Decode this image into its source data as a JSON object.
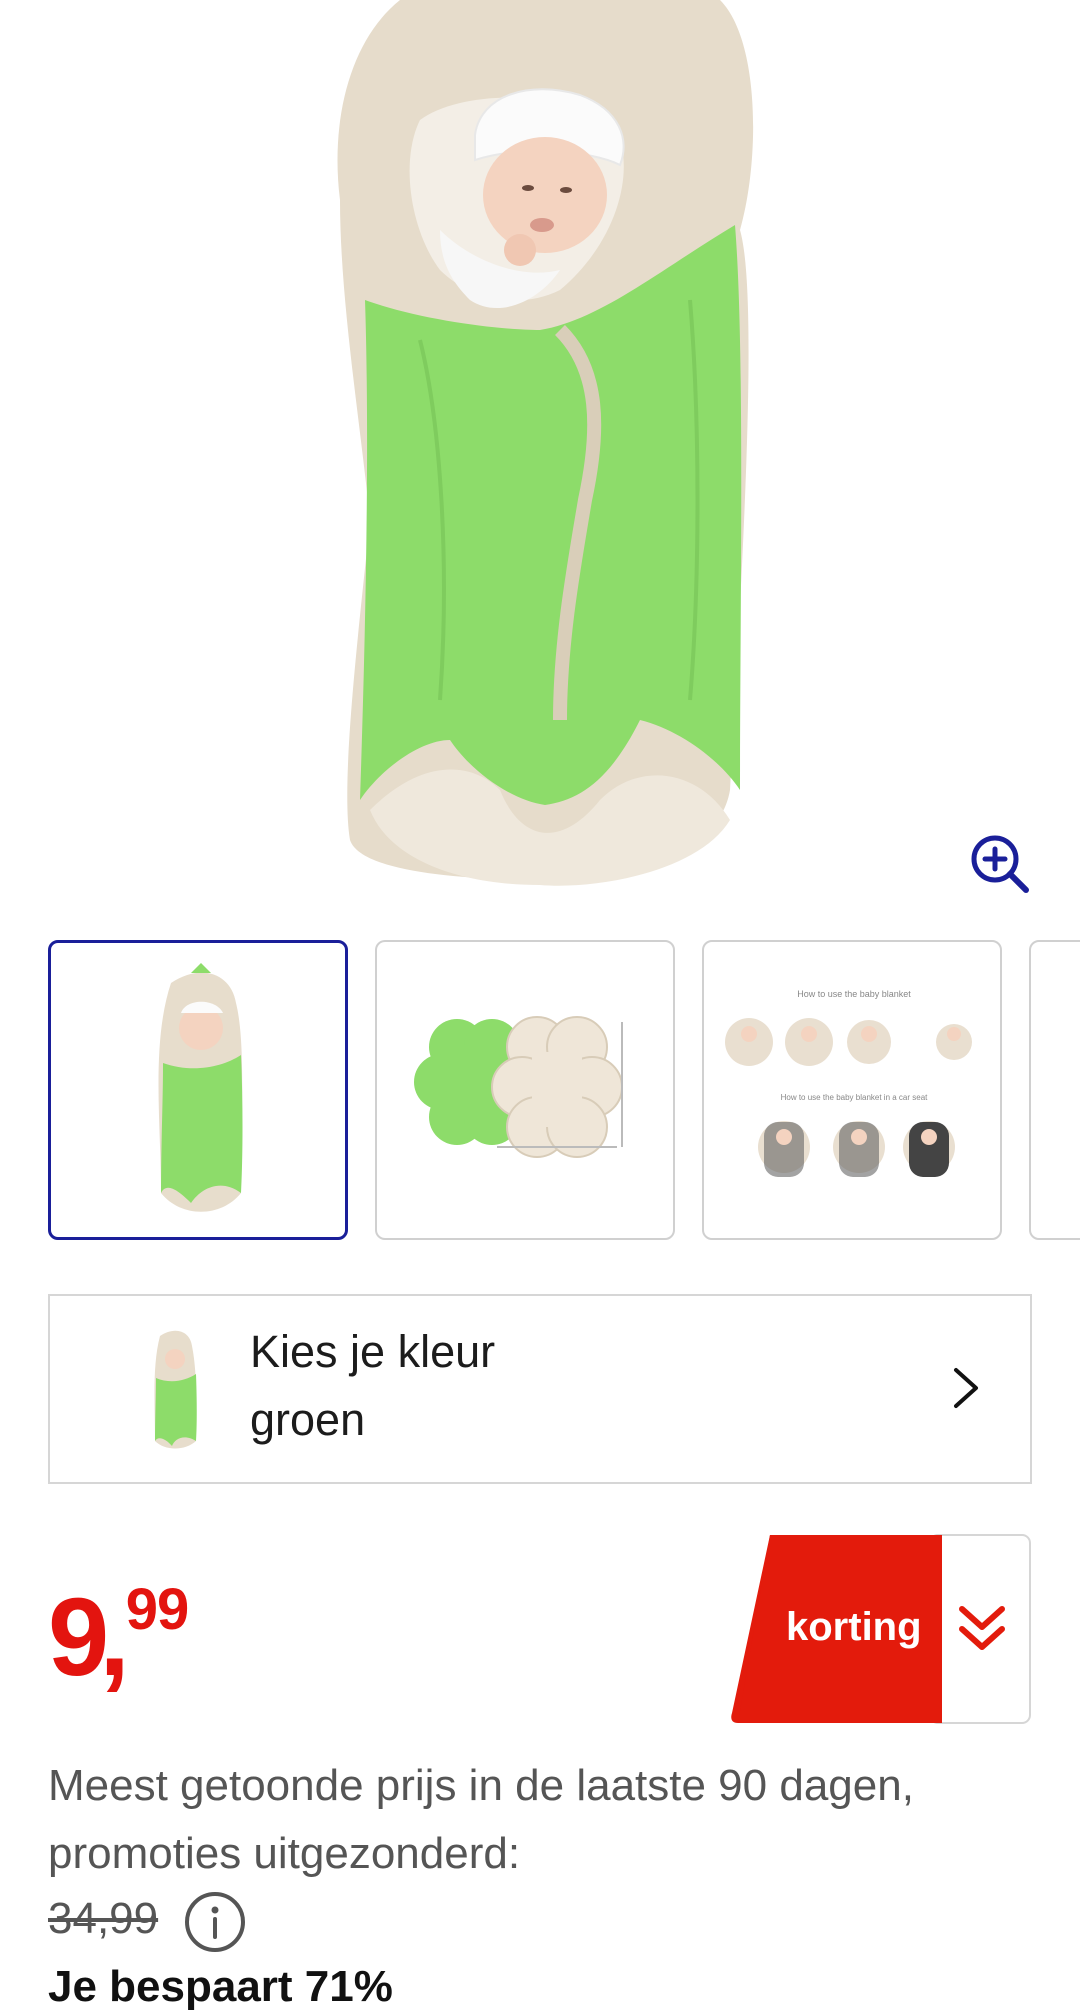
{
  "product": {
    "gallery": {
      "zoom_icon": "zoom-in-icon",
      "thumbnails": [
        {
          "name": "blanket-baby-photo",
          "active": true
        },
        {
          "name": "blanket-flat-photo",
          "active": false
        },
        {
          "name": "blanket-instructions-photo",
          "active": false,
          "caption_top": "How to use the baby blanket",
          "caption_bottom": "How to use the baby blanket in a car seat"
        }
      ]
    },
    "color_selector": {
      "title": "Kies je kleur",
      "value": "groen",
      "icon": "chevron-right-icon"
    },
    "price": {
      "integer": "9",
      "comma": ",",
      "decimals": "99",
      "color": "#e3140f"
    },
    "discount_badge": {
      "label": "korting",
      "icon": "double-chevron-down-icon",
      "color": "#e31b0c"
    },
    "price_info": {
      "text": "Meest getoonde prijs in de laatste 90 dagen, promoties uitgezonderd:",
      "old_price": "34,99",
      "info_icon": "info-icon",
      "savings": "Je bespaart 71%"
    }
  }
}
